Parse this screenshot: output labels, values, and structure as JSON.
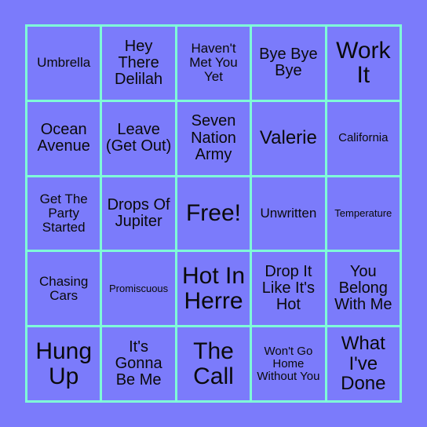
{
  "card": {
    "name": "music-bingo-card",
    "background_color": "#7b7bfb",
    "border_color": "#7ffcd8",
    "text_color": "#0a0a0a",
    "columns": 5,
    "rows": 5,
    "free_space_label": "Free!",
    "cells": [
      {
        "label": "Umbrella",
        "size": "md",
        "free": false
      },
      {
        "label": "Hey There Delilah",
        "size": "lg",
        "free": false
      },
      {
        "label": "Haven't Met You Yet",
        "size": "md",
        "free": false
      },
      {
        "label": "Bye Bye Bye",
        "size": "lg",
        "free": false
      },
      {
        "label": "Work It",
        "size": "xxl",
        "free": false
      },
      {
        "label": "Ocean Avenue",
        "size": "lg",
        "free": false
      },
      {
        "label": "Leave (Get Out)",
        "size": "lg",
        "free": false
      },
      {
        "label": "Seven Nation Army",
        "size": "lg",
        "free": false
      },
      {
        "label": "Valerie",
        "size": "xl",
        "free": false
      },
      {
        "label": "California",
        "size": "sm",
        "free": false
      },
      {
        "label": "Get The Party Started",
        "size": "md",
        "free": false
      },
      {
        "label": "Drops Of Jupiter",
        "size": "lg",
        "free": false
      },
      {
        "label": "Free!",
        "size": "xxl",
        "free": true
      },
      {
        "label": "Unwritten",
        "size": "md",
        "free": false
      },
      {
        "label": "Temperature",
        "size": "xs",
        "free": false
      },
      {
        "label": "Chasing Cars",
        "size": "md",
        "free": false
      },
      {
        "label": "Promiscuous",
        "size": "xs",
        "free": false
      },
      {
        "label": "Hot In Herre",
        "size": "xxl",
        "free": false
      },
      {
        "label": "Drop It Like It's Hot",
        "size": "lg",
        "free": false
      },
      {
        "label": "You Belong With Me",
        "size": "lg",
        "free": false
      },
      {
        "label": "Hung Up",
        "size": "xxl",
        "free": false
      },
      {
        "label": "It's Gonna Be Me",
        "size": "lg",
        "free": false
      },
      {
        "label": "The Call",
        "size": "xxl",
        "free": false
      },
      {
        "label": "Won't Go Home Without You",
        "size": "sm",
        "free": false
      },
      {
        "label": "What I've Done",
        "size": "xl",
        "free": false
      }
    ]
  }
}
